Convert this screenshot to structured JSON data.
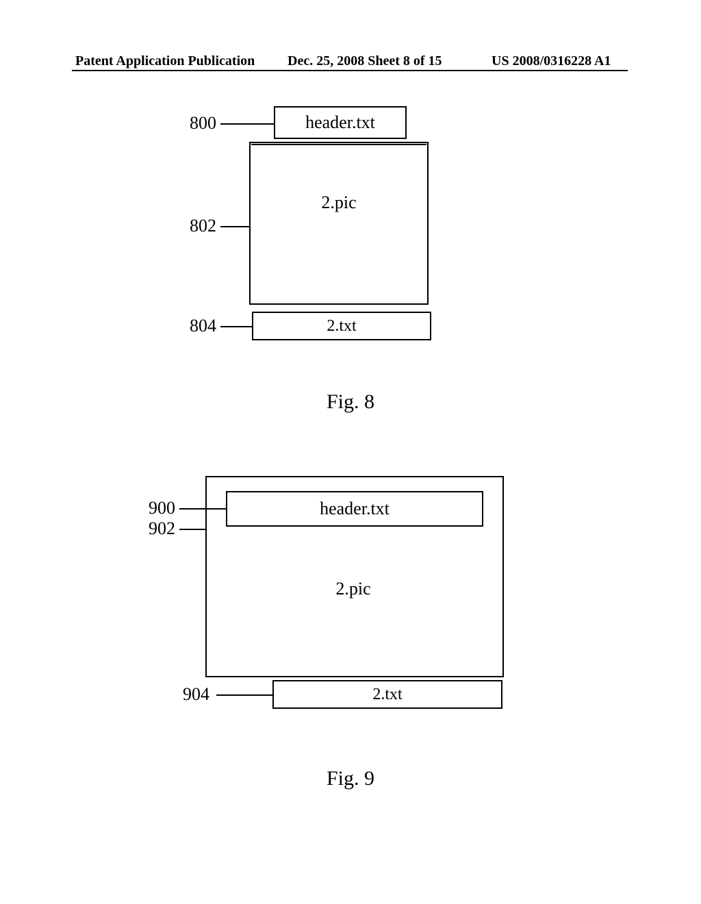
{
  "header": {
    "left": "Patent Application Publication",
    "center": "Dec. 25, 2008  Sheet 8 of 15",
    "right": "US 2008/0316228 A1"
  },
  "fig8": {
    "caption": "Fig. 8",
    "boxes": {
      "header": {
        "ref": "800",
        "text": "header.txt"
      },
      "pic": {
        "ref": "802",
        "text": "2.pic"
      },
      "txt": {
        "ref": "804",
        "text": "2.txt"
      }
    }
  },
  "fig9": {
    "caption": "Fig. 9",
    "boxes": {
      "header": {
        "ref": "900",
        "text": "header.txt"
      },
      "pic": {
        "ref": "902",
        "text": "2.pic"
      },
      "txt": {
        "ref": "904",
        "text": "2.txt"
      }
    }
  }
}
